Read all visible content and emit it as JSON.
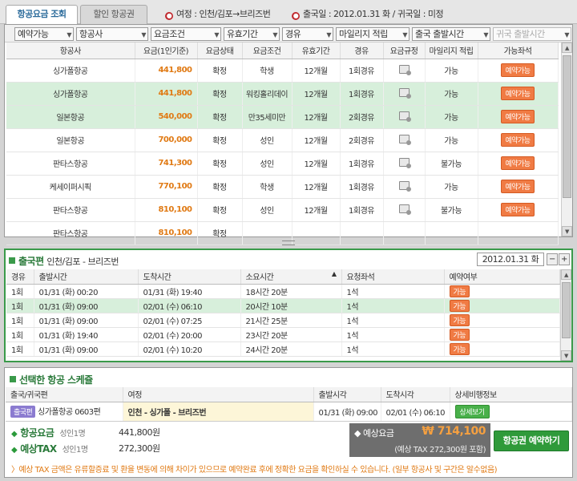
{
  "tabs": [
    "항공요금 조회",
    "할인 항공권"
  ],
  "trip": {
    "route_label": "여정 : 인천/김포→브리즈번",
    "date_label": "출국일 : 2012.01.31 화 / 귀국일 : 미정"
  },
  "filters": [
    "예약가능",
    "항공사",
    "요금조건",
    "유효기간",
    "경유",
    "마일리지 적립",
    "출국 출발시간",
    "귀국 출발시간"
  ],
  "fare_table": {
    "headers": [
      "항공사",
      "요금(1인기준)",
      "요금상태",
      "요금조건",
      "유효기간",
      "경유",
      "요금규정",
      "마일리지 적립",
      "가능좌석"
    ],
    "rows": [
      [
        "싱가폴항공",
        "441,800",
        "확정",
        "학생",
        "12개월",
        "1회경유",
        "",
        "가능",
        "예약가능"
      ],
      [
        "싱가폴항공",
        "441,800",
        "확정",
        "워킹홀리데이",
        "12개월",
        "1회경유",
        "",
        "가능",
        "예약가능"
      ],
      [
        "일본항공",
        "540,000",
        "확정",
        "만35세미만",
        "12개월",
        "2회경유",
        "",
        "가능",
        "예약가능"
      ],
      [
        "일본항공",
        "700,000",
        "확정",
        "성인",
        "12개월",
        "2회경유",
        "",
        "가능",
        "예약가능"
      ],
      [
        "판타스항공",
        "741,300",
        "확정",
        "성인",
        "12개월",
        "1회경유",
        "",
        "불가능",
        "예약가능"
      ],
      [
        "케세이퍼시픽",
        "770,100",
        "확정",
        "학생",
        "12개월",
        "1회경유",
        "",
        "가능",
        "예약가능"
      ],
      [
        "판타스항공",
        "810,100",
        "확정",
        "성인",
        "12개월",
        "1회경유",
        "",
        "불가능",
        "예약가능"
      ],
      [
        "판타스항공",
        "810,100",
        "확정",
        "",
        "",
        "",
        "",
        "",
        ""
      ]
    ]
  },
  "departure": {
    "title": "출국편",
    "route": "인천/김포 - 브리즈번",
    "date": "2012.01.31 화",
    "headers": [
      "경유",
      "출발시간",
      "도착시간",
      "소요시간",
      "요청좌석",
      "예약여부"
    ],
    "rows": [
      [
        "1회",
        "01/31 (화) 00:20",
        "01/31 (화) 19:40",
        "18시간 20분",
        "1석",
        "가능"
      ],
      [
        "1회",
        "01/31 (화) 09:00",
        "02/01 (수) 06:10",
        "20시간 10분",
        "1석",
        "가능"
      ],
      [
        "1회",
        "01/31 (화) 09:00",
        "02/01 (수) 07:25",
        "21시간 25분",
        "1석",
        "가능"
      ],
      [
        "1회",
        "01/31 (화) 19:40",
        "02/01 (수) 20:00",
        "23시간 20분",
        "1석",
        "가능"
      ],
      [
        "1회",
        "01/31 (화) 09:00",
        "02/01 (수) 10:20",
        "24시간 20분",
        "1석",
        "가능"
      ]
    ]
  },
  "selected": {
    "title": "선택한 항공 스케쥴",
    "headers": [
      "출국/귀국편",
      "여정",
      "출발시각",
      "도착시각",
      "상세비행정보"
    ],
    "row": {
      "badge": "출국편",
      "flight": "싱가폴항공 0603편",
      "route": "인천 - 싱가폴 - 브리즈번",
      "dep": "01/31 (화) 09:00",
      "arr": "02/01 (수) 06:10",
      "detail": "상세보기"
    }
  },
  "summary": {
    "fare_label": "항공요금",
    "fare_sub": "성인1명",
    "fare_value": "441,800원",
    "tax_label": "예상TAX",
    "tax_sub": "성인1명",
    "tax_value": "272,300원",
    "total_label": "예상요금",
    "total_value": "₩ 714,100",
    "total_note": "(예상 TAX 272,300원 포함)",
    "book_button": "항공권 예약하기"
  },
  "footnote": "예상 TAX 금액은 유류할증료 및 환율 변동에 의해 차이가 있으므로 예약완료 후에 정확한 요금을 확인하실 수 있습니다. (일부 항공사 및 구간은 알수없음)",
  "colors": {
    "accent_orange": "#e07a14",
    "highlight_green": "#d7efdb",
    "book_green": "#2f9a3a"
  }
}
